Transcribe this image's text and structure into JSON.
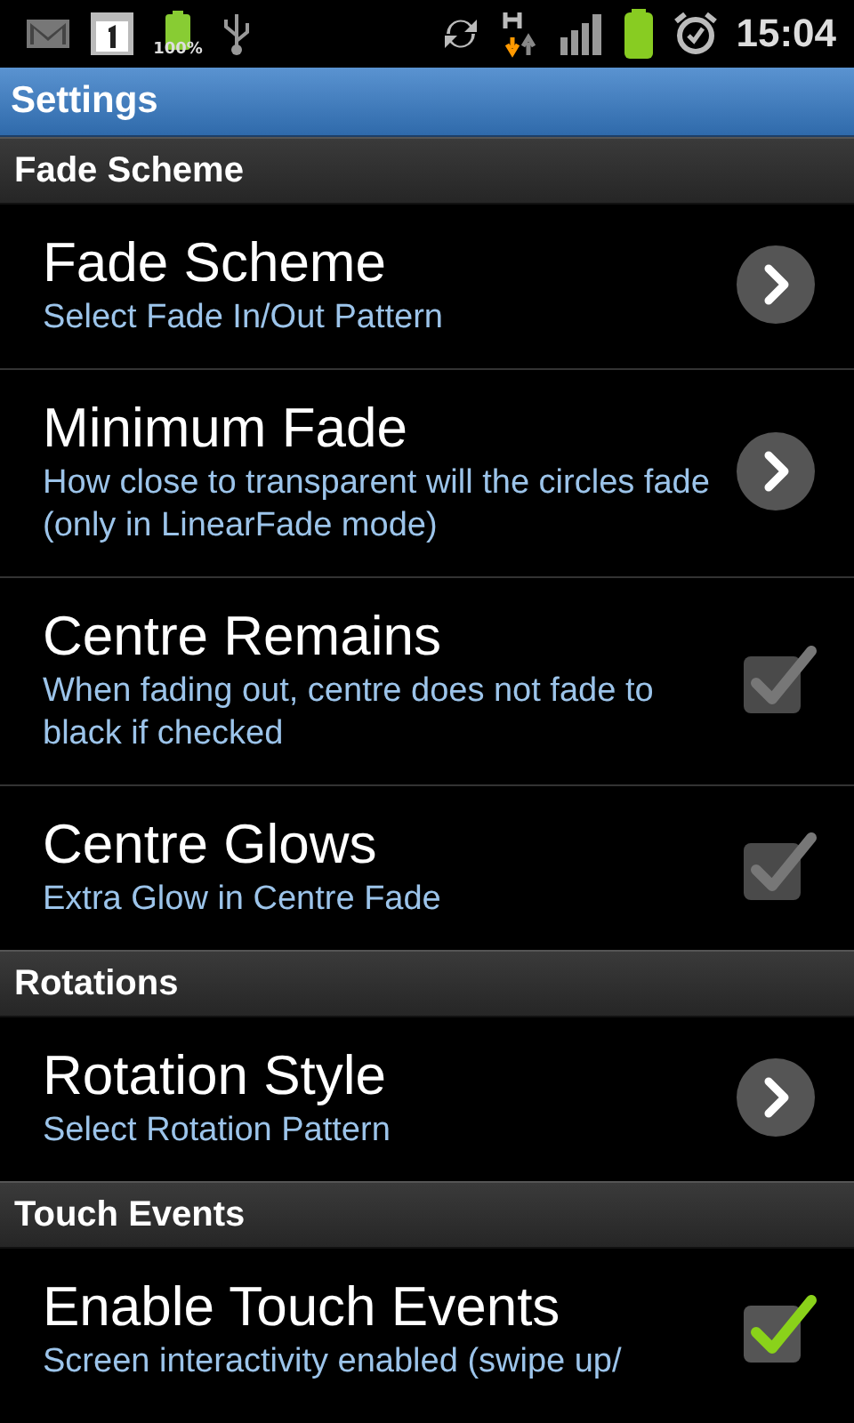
{
  "status_bar": {
    "battery_percent": "100%",
    "time": "15:04"
  },
  "title_bar": {
    "title": "Settings"
  },
  "sections": [
    {
      "header": "Fade Scheme",
      "items": [
        {
          "kind": "link",
          "title": "Fade Scheme",
          "summary": "Select Fade In/Out Pattern"
        },
        {
          "kind": "link",
          "title": "Minimum Fade",
          "summary": "How close to transparent will the circles fade (only in LinearFade mode)"
        },
        {
          "kind": "checkbox",
          "title": "Centre Remains",
          "summary": "When fading out, centre does not fade to black if checked",
          "checked": true,
          "disabled": true
        },
        {
          "kind": "checkbox",
          "title": "Centre Glows",
          "summary": "Extra Glow in Centre Fade",
          "checked": true,
          "disabled": true
        }
      ]
    },
    {
      "header": "Rotations",
      "items": [
        {
          "kind": "link",
          "title": "Rotation Style",
          "summary": "Select Rotation Pattern"
        }
      ]
    },
    {
      "header": "Touch Events",
      "items": [
        {
          "kind": "checkbox",
          "title": "Enable Touch Events",
          "summary": "Screen interactivity enabled (swipe up/",
          "checked": true,
          "disabled": false
        }
      ]
    }
  ]
}
